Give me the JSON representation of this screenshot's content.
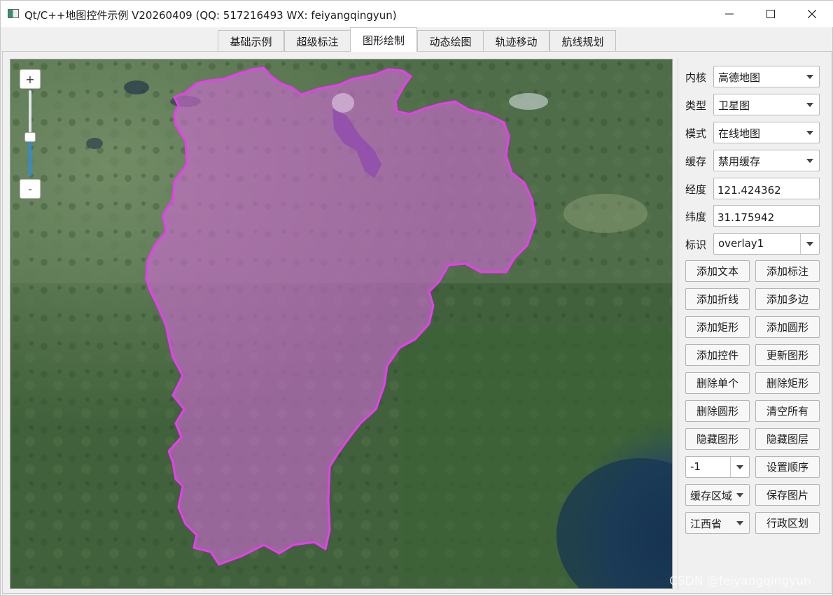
{
  "window": {
    "title": "Qt/C++地图控件示例 V20260409 (QQ: 517216493 WX: feiyangqingyun)"
  },
  "tabs": [
    {
      "label": "基础示例"
    },
    {
      "label": "超级标注"
    },
    {
      "label": "图形绘制",
      "active": true
    },
    {
      "label": "动态绘图"
    },
    {
      "label": "轨迹移动"
    },
    {
      "label": "航线规划"
    }
  ],
  "map": {
    "zoom_in": "+",
    "zoom_out": "-",
    "zoom_level_fraction": 0.45,
    "overlay_color": "#e040f0",
    "watermark": "CSDN @feiyangqingyun"
  },
  "panel": {
    "kernel": {
      "label": "内核",
      "value": "高德地图"
    },
    "type": {
      "label": "类型",
      "value": "卫星图"
    },
    "mode": {
      "label": "模式",
      "value": "在线地图"
    },
    "cache": {
      "label": "缓存",
      "value": "禁用缓存"
    },
    "longitude": {
      "label": "经度",
      "value": "121.424362"
    },
    "latitude": {
      "label": "纬度",
      "value": "31.175942"
    },
    "identifier": {
      "label": "标识",
      "value": "overlay1"
    },
    "buttons": {
      "add_text": "添加文本",
      "add_marker": "添加标注",
      "add_polyline": "添加折线",
      "add_polygon": "添加多边",
      "add_rect": "添加矩形",
      "add_circle": "添加圆形",
      "add_control": "添加控件",
      "update_shape": "更新图形",
      "delete_single": "删除单个",
      "delete_rect": "删除矩形",
      "delete_circle": "删除圆形",
      "clear_all": "清空所有",
      "hide_shape": "隐藏图形",
      "hide_layer": "隐藏图层",
      "set_order": "设置顺序",
      "save_image": "保存图片",
      "admin_region": "行政区划"
    },
    "order_value": "-1",
    "cache_region_value": "缓存区域",
    "province_value": "江西省"
  }
}
